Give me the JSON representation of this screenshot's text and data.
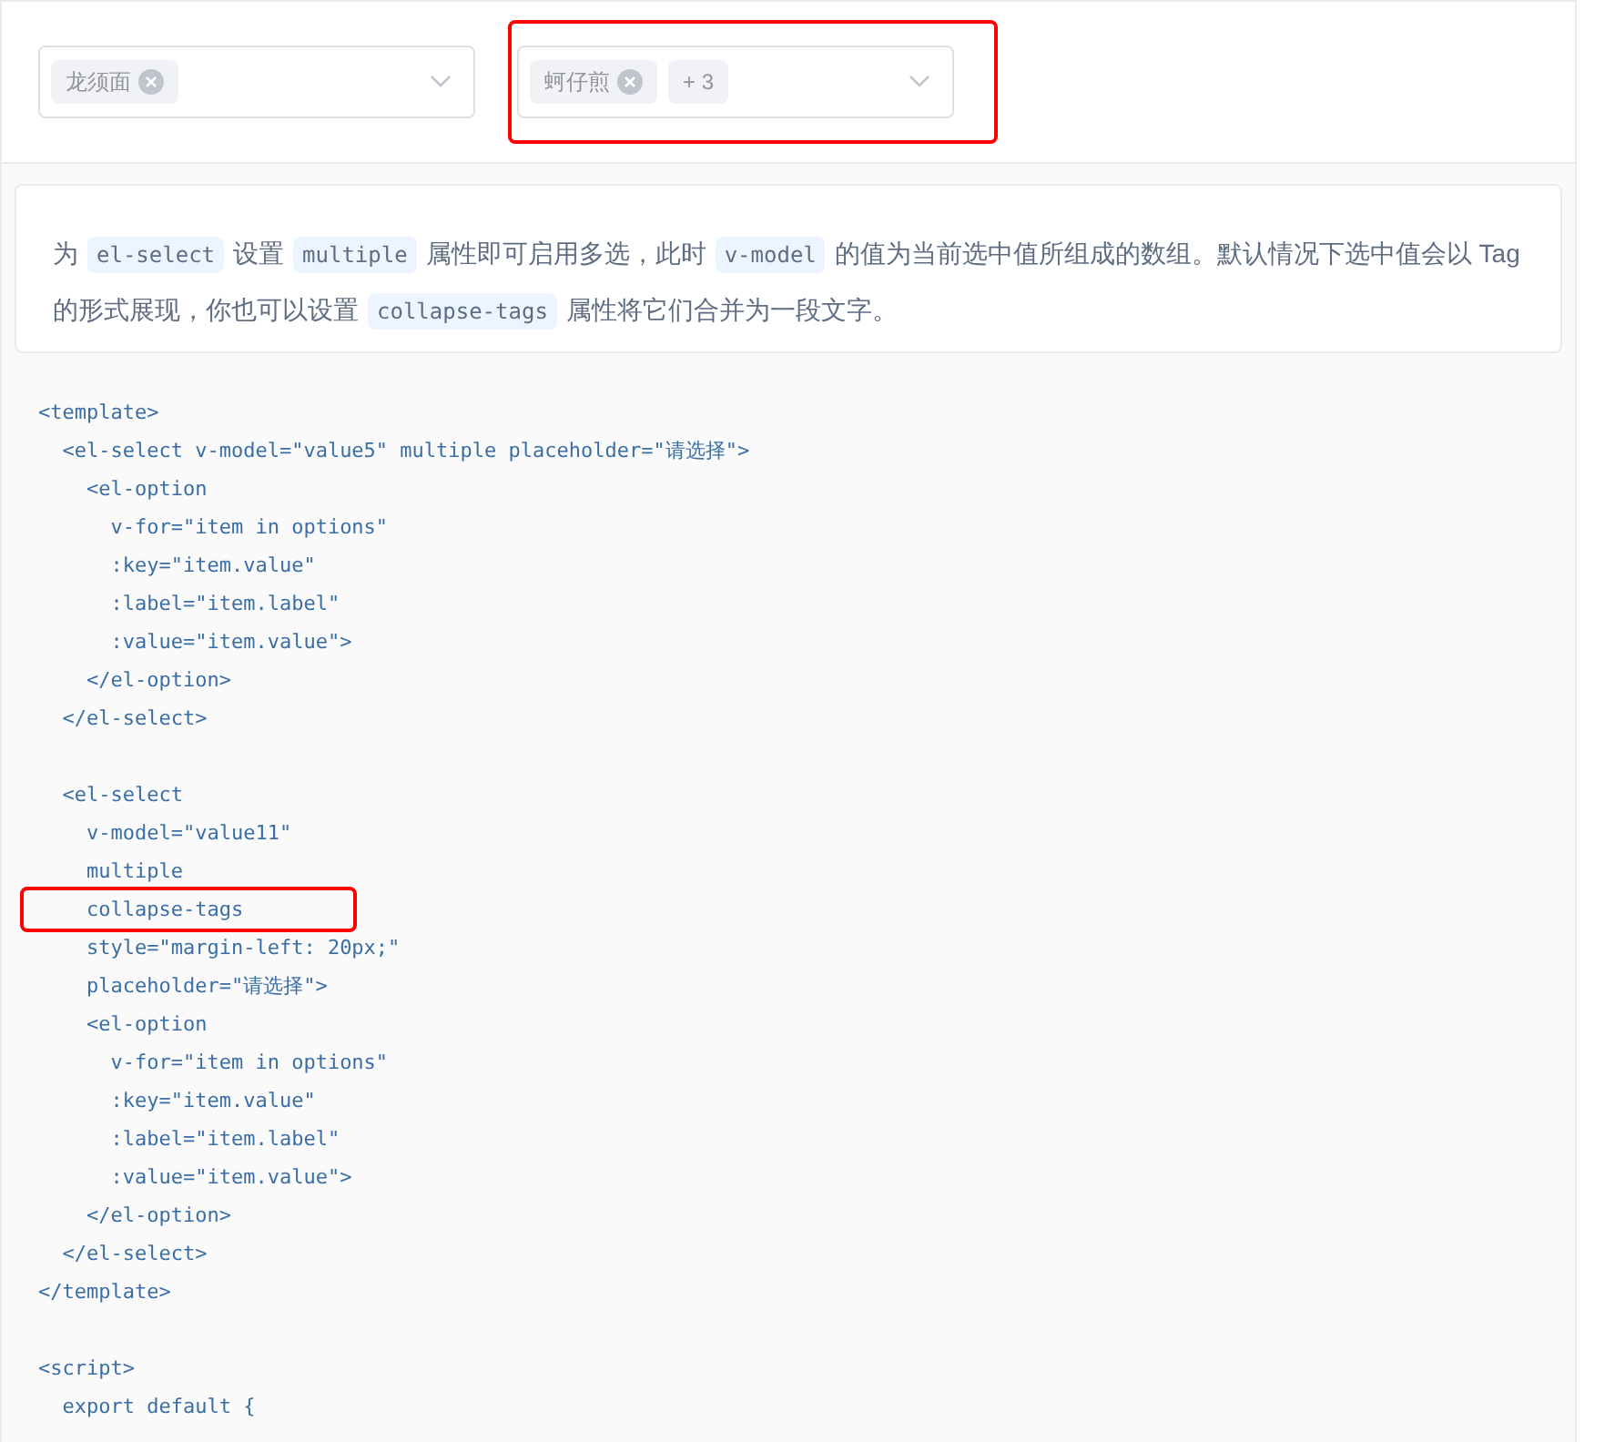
{
  "selects": [
    {
      "highlighted": false,
      "tags": [
        {
          "kind": "removable",
          "label": "龙须面"
        }
      ]
    },
    {
      "highlighted": true,
      "tags": [
        {
          "kind": "removable",
          "label": "蚵仔煎"
        },
        {
          "kind": "count",
          "label": "+ 3"
        }
      ]
    }
  ],
  "description": {
    "lines": [
      [
        {
          "kind": "text",
          "text": "为"
        },
        {
          "kind": "code",
          "text": "el-select"
        },
        {
          "kind": "text",
          "text": "设置"
        },
        {
          "kind": "code",
          "text": "multiple"
        },
        {
          "kind": "text",
          "text": "属性即可启用多选，此时"
        },
        {
          "kind": "code",
          "text": "v-model"
        },
        {
          "kind": "text",
          "text": "的值为当前选中值所组成的数组。默认情况下选中值会以 Tag"
        }
      ],
      [
        {
          "kind": "text",
          "text": "的形式展现，你也可以设置"
        },
        {
          "kind": "code",
          "text": "collapse-tags"
        },
        {
          "kind": "text",
          "text": "属性将它们合并为一段文字。"
        }
      ]
    ]
  },
  "code_block": {
    "sections": [
      [
        {
          "text": "<template>",
          "highlighted": false
        },
        {
          "text": "  <el-select v-model=\"value5\" multiple placeholder=\"请选择\">",
          "highlighted": false
        },
        {
          "text": "    <el-option",
          "highlighted": false
        },
        {
          "text": "      v-for=\"item in options\"",
          "highlighted": false
        },
        {
          "text": "      :key=\"item.value\"",
          "highlighted": false
        },
        {
          "text": "      :label=\"item.label\"",
          "highlighted": false
        },
        {
          "text": "      :value=\"item.value\">",
          "highlighted": false
        },
        {
          "text": "    </el-option>",
          "highlighted": false
        },
        {
          "text": "  </el-select>",
          "highlighted": false
        }
      ],
      [
        {
          "text": "  <el-select",
          "highlighted": false
        },
        {
          "text": "    v-model=\"value11\"",
          "highlighted": false
        },
        {
          "text": "    multiple",
          "highlighted": false
        },
        {
          "text": "    collapse-tags",
          "highlighted": true
        },
        {
          "text": "    style=\"margin-left: 20px;\"",
          "highlighted": false
        },
        {
          "text": "    placeholder=\"请选择\">",
          "highlighted": false
        },
        {
          "text": "    <el-option",
          "highlighted": false
        },
        {
          "text": "      v-for=\"item in options\"",
          "highlighted": false
        },
        {
          "text": "      :key=\"item.value\"",
          "highlighted": false
        },
        {
          "text": "      :label=\"item.label\"",
          "highlighted": false
        },
        {
          "text": "      :value=\"item.value\">",
          "highlighted": false
        },
        {
          "text": "    </el-option>",
          "highlighted": false
        },
        {
          "text": "  </el-select>",
          "highlighted": false
        },
        {
          "text": "</template>",
          "highlighted": false
        }
      ],
      [
        {
          "text": "<script>",
          "highlighted": false
        },
        {
          "text": "  export default {",
          "highlighted": false
        }
      ]
    ]
  }
}
